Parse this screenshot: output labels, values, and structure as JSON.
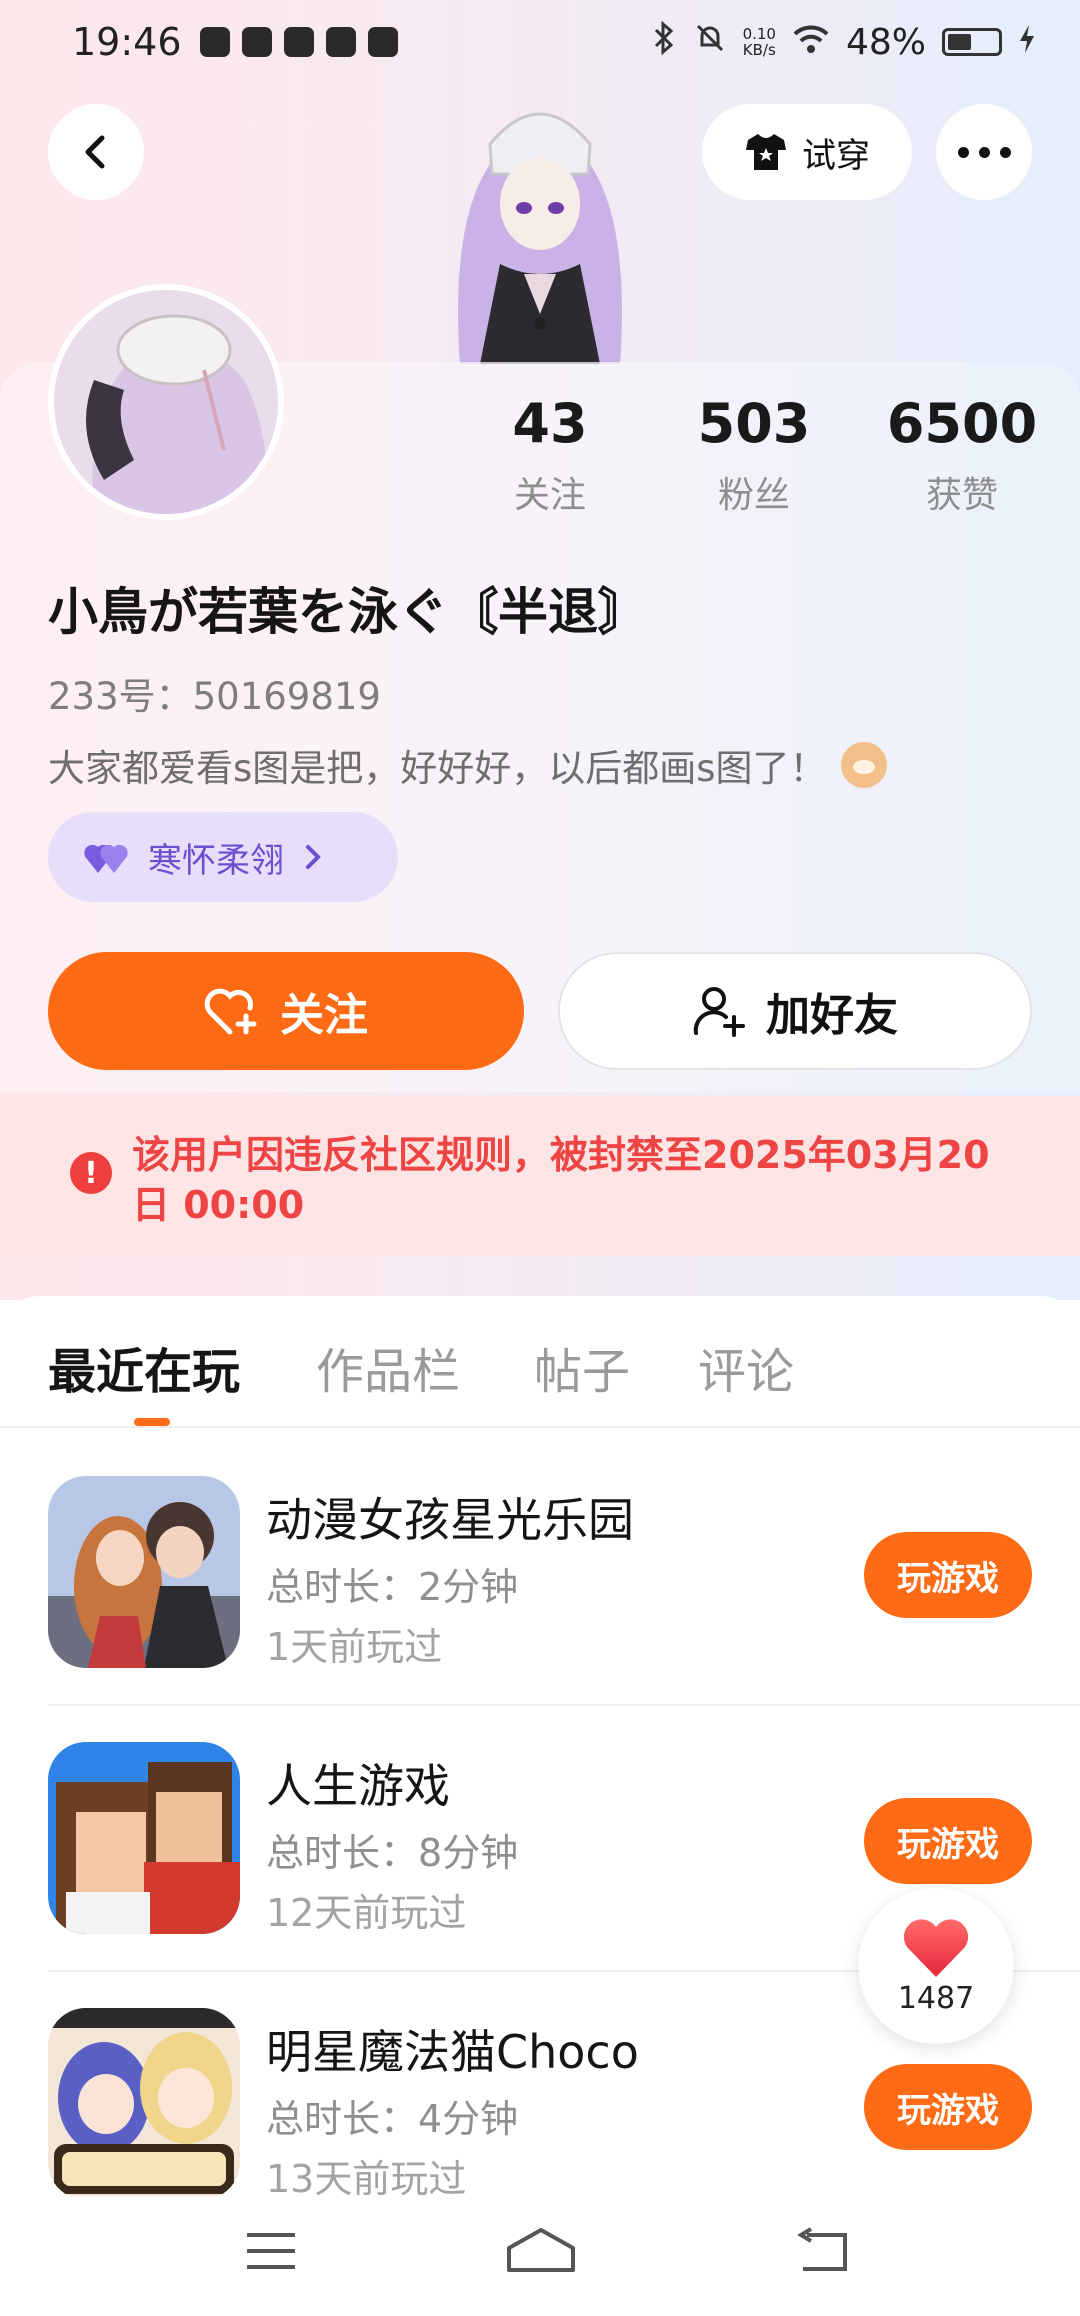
{
  "status_bar": {
    "time": "19:46",
    "network_speed_value": "0.10",
    "network_speed_unit": "KB/s",
    "battery": "48%",
    "battery_level": 0.48
  },
  "header": {
    "tryon_label": "试穿"
  },
  "profile": {
    "stats": [
      {
        "value": "43",
        "label": "关注"
      },
      {
        "value": "503",
        "label": "粉丝"
      },
      {
        "value": "6500",
        "label": "获赞"
      }
    ],
    "username": "小鳥が若葉を泳ぐ〘半退〙",
    "account_id": "233号：50169819",
    "bio": "大家都爱看s图是把，好好好，以后都画s图了！",
    "tag_label": "寒怀柔翎",
    "follow_label": "关注",
    "add_friend_label": "加好友"
  },
  "ban_notice": {
    "text": "该用户因违反社区规则，被封禁至2025年03月20日 00:00"
  },
  "tabs": [
    {
      "label": "最近在玩",
      "active": true
    },
    {
      "label": "作品栏",
      "active": false
    },
    {
      "label": "帖子",
      "active": false
    },
    {
      "label": "评论",
      "active": false
    }
  ],
  "games": [
    {
      "title": "动漫女孩星光乐园",
      "duration": "总时长：2分钟",
      "last_played": "1天前玩过",
      "button": "玩游戏"
    },
    {
      "title": "人生游戏",
      "duration": "总时长：8分钟",
      "last_played": "12天前玩过",
      "button": "玩游戏"
    },
    {
      "title": "明星魔法猫Choco",
      "duration": "总时长：4分钟",
      "last_played": "13天前玩过",
      "button": "玩游戏"
    }
  ],
  "like_float": {
    "count": "1487"
  },
  "colors": {
    "accent_orange": "#ff6a14",
    "ban_red": "#ee4444",
    "tag_purple": "#6b4fd0"
  }
}
